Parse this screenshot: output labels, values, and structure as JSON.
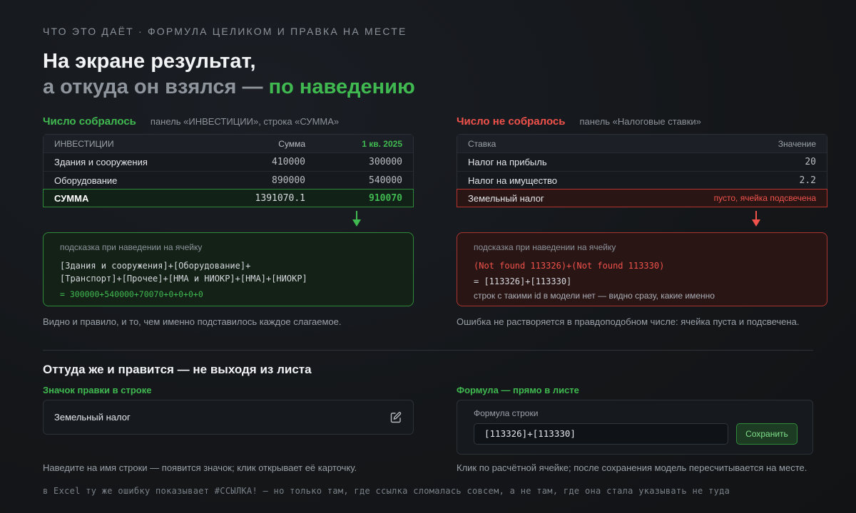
{
  "eyebrow": "ЧТО ЭТО ДАЁТ · ФОРМУЛА ЦЕЛИКОМ И ПРАВКА НА МЕСТЕ",
  "title": {
    "line1": "На экране результат,",
    "line2_prefix": "а откуда он взялся — ",
    "line2_accent": "по наведению"
  },
  "left": {
    "heading": "Число собралось",
    "subheading": "панель «ИНВЕСТИЦИИ», строка «СУММА»",
    "table": {
      "headers": [
        "ИНВЕСТИЦИИ",
        "Сумма",
        "1 кв. 2025"
      ],
      "rows": [
        [
          "Здания и сооружения",
          "410000",
          "300000"
        ],
        [
          "Оборудование",
          "890000",
          "540000"
        ],
        [
          "СУММА",
          "1391070.1",
          "910070"
        ]
      ]
    },
    "tooltip": {
      "label": "подсказка при наведении на ячейку",
      "formula_line1": "[Здания и сооружения]+[Оборудование]+",
      "formula_line2": "[Транспорт]+[Прочее]+[НМА и НИОКР]+[НМА]+[НИОКР]",
      "result": "= 300000+540000+70070+0+0+0+0"
    },
    "caption": "Видно и правило, и то, чем именно подставилось каждое слагаемое."
  },
  "right": {
    "heading": "Число не собралось",
    "subheading": "панель «Налоговые ставки»",
    "table": {
      "headers": [
        "Ставка",
        "Значение"
      ],
      "rows": [
        [
          "Налог на прибыль",
          "20"
        ],
        [
          "Налог на имущество",
          "2.2"
        ],
        [
          "Земельный налог",
          "пусто, ячейка подсвечена"
        ]
      ]
    },
    "tooltip": {
      "label": "подсказка при наведении на ячейку",
      "error_line": "(Not found 113326)+(Not found 113330)",
      "ids_line": "= [113326]+[113330]",
      "note": "строк с такими id в модели нет — видно сразу, какие именно"
    },
    "caption": "Ошибка не растворяется в правдоподобном числе: ячейка пуста и подсвечена."
  },
  "edit_section": {
    "heading": "Оттуда же и правится — не выходя из листа",
    "left": {
      "subheading": "Значок правки в строке",
      "row_label": "Земельный налог",
      "caption": "Наведите на имя строки — появится значок; клик открывает её карточку."
    },
    "right": {
      "subheading": "Формула — прямо в листе",
      "field_label": "Формула строки",
      "field_value": "[113326]+[113330]",
      "save_label": "Сохранить",
      "caption": "Клик по расчётной ячейке; после сохранения модель пересчитывается на месте."
    }
  },
  "footer": "в Excel ту же ошибку показывает #ССЫЛКА! — но только там, где ссылка сломалась совсем, а не там, где она стала указывать не туда",
  "colors": {
    "ok": "#3fb950",
    "error": "#f0524b"
  }
}
